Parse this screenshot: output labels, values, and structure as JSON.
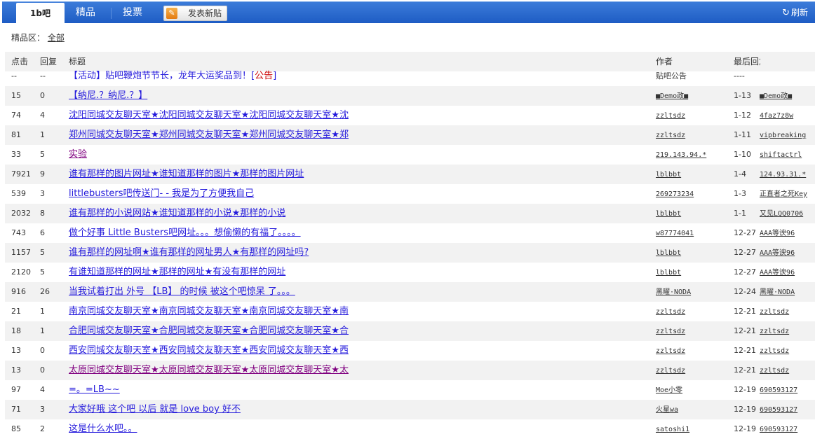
{
  "nav": {
    "active_tab": "1b吧",
    "tabs": [
      "精品",
      "投票"
    ],
    "post_button": "发表新贴",
    "refresh": "刷新"
  },
  "filter": {
    "label": "精品区：",
    "value": "全部"
  },
  "table": {
    "headers": {
      "clicks": "点击",
      "replies": "回复",
      "title": "标题",
      "author": "作者",
      "last_reply": "最后回复"
    },
    "announcement": {
      "clicks": "--",
      "replies": "--",
      "title": "【活动】贴吧鞭炮节节长，龙年大运奖品到！",
      "tag": "公告",
      "author": "贴吧公告",
      "last": "----"
    },
    "rows": [
      {
        "clicks": "15",
        "replies": "0",
        "title": "【纳尼.？纳尼.？】",
        "author": "■Demo政■",
        "date": "1-13",
        "last": "■Demo政■"
      },
      {
        "clicks": "74",
        "replies": "4",
        "title": "沈阳同城交友聊天室★沈阳同城交友聊天室★沈阳同城交友聊天室★沈",
        "author": "zzltsdz",
        "date": "1-12",
        "last": "4faz7z8w"
      },
      {
        "clicks": "81",
        "replies": "1",
        "title": "郑州同城交友聊天室★郑州同城交友聊天室★郑州同城交友聊天室★郑",
        "author": "zzltsdz",
        "date": "1-11",
        "last": "vipbreaking"
      },
      {
        "clicks": "33",
        "replies": "5",
        "title": "实验",
        "author": "219.143.94.*",
        "date": "1-10",
        "last": "shiftactrl",
        "visited": true
      },
      {
        "clicks": "7921",
        "replies": "9",
        "title": "谁有那样的图片网址★谁知道那样的图片★那样的图片网址",
        "author": "lblbbt",
        "date": "1-4",
        "last": "124.93.31.*"
      },
      {
        "clicks": "539",
        "replies": "3",
        "title": "littlebusters吧传送门- - 我是为了方便我自己",
        "author": "269273234",
        "date": "1-3",
        "last": "正直者之死Key"
      },
      {
        "clicks": "2032",
        "replies": "8",
        "title": "谁有那样的小说网站★谁知道那样的小说★那样的小说",
        "author": "lblbbt",
        "date": "1-1",
        "last": "又见LQQ0706"
      },
      {
        "clicks": "743",
        "replies": "6",
        "title": "做个好事 Little Busters吧网址。。。想偷懒的有福了。。。。",
        "author": "w87774041",
        "date": "12-27",
        "last": "AAA等谀96"
      },
      {
        "clicks": "1157",
        "replies": "5",
        "title": "谁有那样的网址啊★谁有那样的网址男人★有那样的网址吗?",
        "author": "lblbbt",
        "date": "12-27",
        "last": "AAA等谀96"
      },
      {
        "clicks": "2120",
        "replies": "5",
        "title": "有谁知道那样的网址★那样的网址★有没有那样的网址",
        "author": "lblbbt",
        "date": "12-27",
        "last": "AAA等谀96"
      },
      {
        "clicks": "916",
        "replies": "26",
        "title": "当我试着打出 外号 【LB】 的时候 被这个吧惊呆 了。。。",
        "author": "黑曜·NODA",
        "date": "12-24",
        "last": "黑曜·NODA"
      },
      {
        "clicks": "21",
        "replies": "1",
        "title": "南京同城交友聊天室★南京同城交友聊天室★南京同城交友聊天室★南",
        "author": "zzltsdz",
        "date": "12-21",
        "last": "zzltsdz"
      },
      {
        "clicks": "18",
        "replies": "1",
        "title": "合肥同城交友聊天室★合肥同城交友聊天室★合肥同城交友聊天室★合",
        "author": "zzltsdz",
        "date": "12-21",
        "last": "zzltsdz"
      },
      {
        "clicks": "13",
        "replies": "0",
        "title": "西安同城交友聊天室★西安同城交友聊天室★西安同城交友聊天室★西",
        "author": "zzltsdz",
        "date": "12-21",
        "last": "zzltsdz"
      },
      {
        "clicks": "13",
        "replies": "0",
        "title": "太原同城交友聊天室★太原同城交友聊天室★太原同城交友聊天室★太",
        "author": "zzltsdz",
        "date": "12-21",
        "last": "zzltsdz",
        "visited": true
      },
      {
        "clicks": "97",
        "replies": "4",
        "title": "=。=LB~~",
        "author": "Moe小零",
        "date": "12-19",
        "last": "690593127"
      },
      {
        "clicks": "71",
        "replies": "3",
        "title": "大家好哦 这个吧 以后 就是 love boy 好不",
        "author": "火星wa",
        "date": "12-19",
        "last": "690593127"
      },
      {
        "clicks": "85",
        "replies": "2",
        "title": "这是什么水吧。。",
        "author": "satoshi1",
        "date": "12-19",
        "last": "690593127"
      }
    ]
  }
}
